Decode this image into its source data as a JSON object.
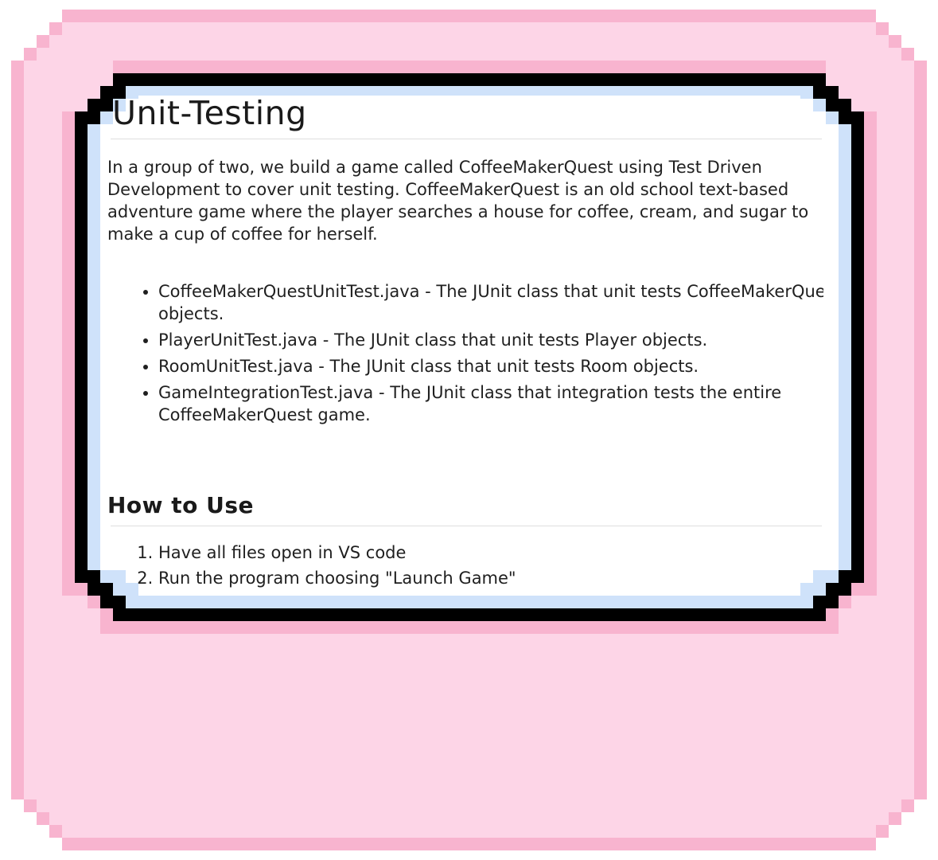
{
  "readme": {
    "title": "Unit-Testing",
    "intro": "In a group of two, we build a game called CoffeeMakerQuest using Test Driven Development to cover unit testing. CoffeeMakerQuest is an old school text-based adventure game where the player searches a house for coffee, cream, and sugar to make a cup of coffee for herself.",
    "files": [
      "CoffeeMakerQuestUnitTest.java - The JUnit class that unit tests CoffeeMakerQuest objects.",
      "PlayerUnitTest.java - The JUnit class that unit tests Player objects.",
      "RoomUnitTest.java - The JUnit class that unit tests Room objects.",
      "GameIntegrationTest.java - The JUnit class that integration tests the entire CoffeeMakerQuest game."
    ],
    "how_to_use_heading": "How to Use",
    "steps": [
      "Have all files open in VS code",
      "Run the program choosing \"Launch Game\""
    ]
  },
  "colors": {
    "card_fill": "#fdd5e7",
    "card_edge": "#f8b4cf",
    "frame_outer": "#000000",
    "frame_inner": "#cfe2fa",
    "content_bg": "#ffffff"
  }
}
